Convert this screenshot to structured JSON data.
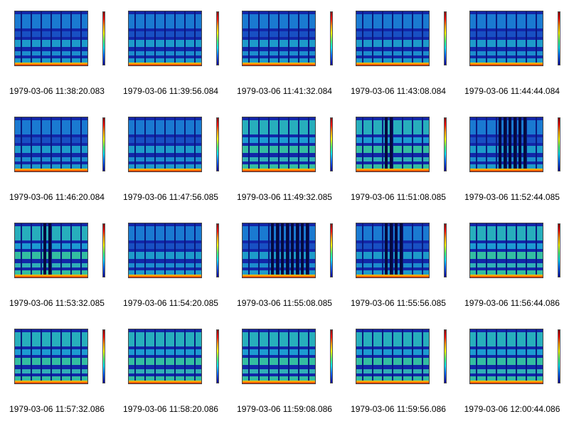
{
  "thumbnails": [
    {
      "caption": "1979-03-06 11:38:20.083"
    },
    {
      "caption": "1979-03-06 11:39:56.084"
    },
    {
      "caption": "1979-03-06 11:41:32.084"
    },
    {
      "caption": "1979-03-06 11:43:08.084"
    },
    {
      "caption": "1979-03-06 11:44:44.084"
    },
    {
      "caption": "1979-03-06 11:46:20.084"
    },
    {
      "caption": "1979-03-06 11:47:56.085"
    },
    {
      "caption": "1979-03-06 11:49:32.085"
    },
    {
      "caption": "1979-03-06 11:51:08.085"
    },
    {
      "caption": "1979-03-06 11:52:44.085"
    },
    {
      "caption": "1979-03-06 11:53:32.085"
    },
    {
      "caption": "1979-03-06 11:54:20.085"
    },
    {
      "caption": "1979-03-06 11:55:08.085"
    },
    {
      "caption": "1979-03-06 11:55:56.085"
    },
    {
      "caption": "1979-03-06 11:56:44.086"
    },
    {
      "caption": "1979-03-06 11:57:32.086"
    },
    {
      "caption": "1979-03-06 11:58:20.086"
    },
    {
      "caption": "1979-03-06 11:59:08.086"
    },
    {
      "caption": "1979-03-06 11:59:56.086"
    },
    {
      "caption": "1979-03-06 12:00:44.086"
    }
  ],
  "colors": {
    "background": "#ffffff",
    "spectrogram_base": "#1226a8",
    "caption_text": "#000000"
  }
}
